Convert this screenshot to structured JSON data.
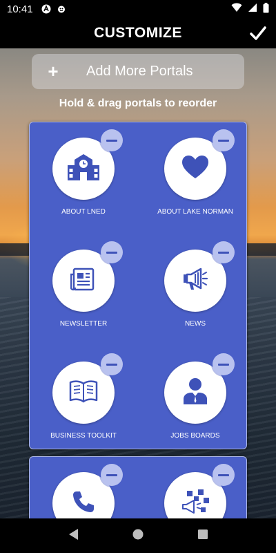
{
  "status_bar": {
    "time": "10:41",
    "left_icons": [
      "app-notification-icon",
      "bug-icon"
    ],
    "right_icons": [
      "wifi-icon",
      "cellular-signal-icon",
      "battery-icon"
    ]
  },
  "header": {
    "title": "CUSTOMIZE",
    "done_icon": "checkmark-icon"
  },
  "add_button": {
    "plus": "+",
    "label": "Add More Portals"
  },
  "hint": "Hold & drag portals to reorder",
  "portals": [
    {
      "label": "ABOUT LNED",
      "icon": "school-building-icon"
    },
    {
      "label": "ABOUT LAKE NORMAN",
      "icon": "heart-icon"
    },
    {
      "label": "NEWSLETTER",
      "icon": "newspaper-icon"
    },
    {
      "label": "NEWS",
      "icon": "megaphone-icon"
    },
    {
      "label": "BUSINESS TOOLKIT",
      "icon": "open-book-icon"
    },
    {
      "label": "JOBS BOARDS",
      "icon": "businessman-icon"
    },
    {
      "label": "",
      "icon": "phone-icon"
    },
    {
      "label": "",
      "icon": "social-media-megaphone-icon"
    }
  ],
  "nav_bar": [
    "back-icon",
    "home-icon",
    "recents-icon"
  ],
  "colors": {
    "panel": "#4a5fc8",
    "icon": "#3e52b8",
    "remove_badge": "#b9c2ef"
  }
}
